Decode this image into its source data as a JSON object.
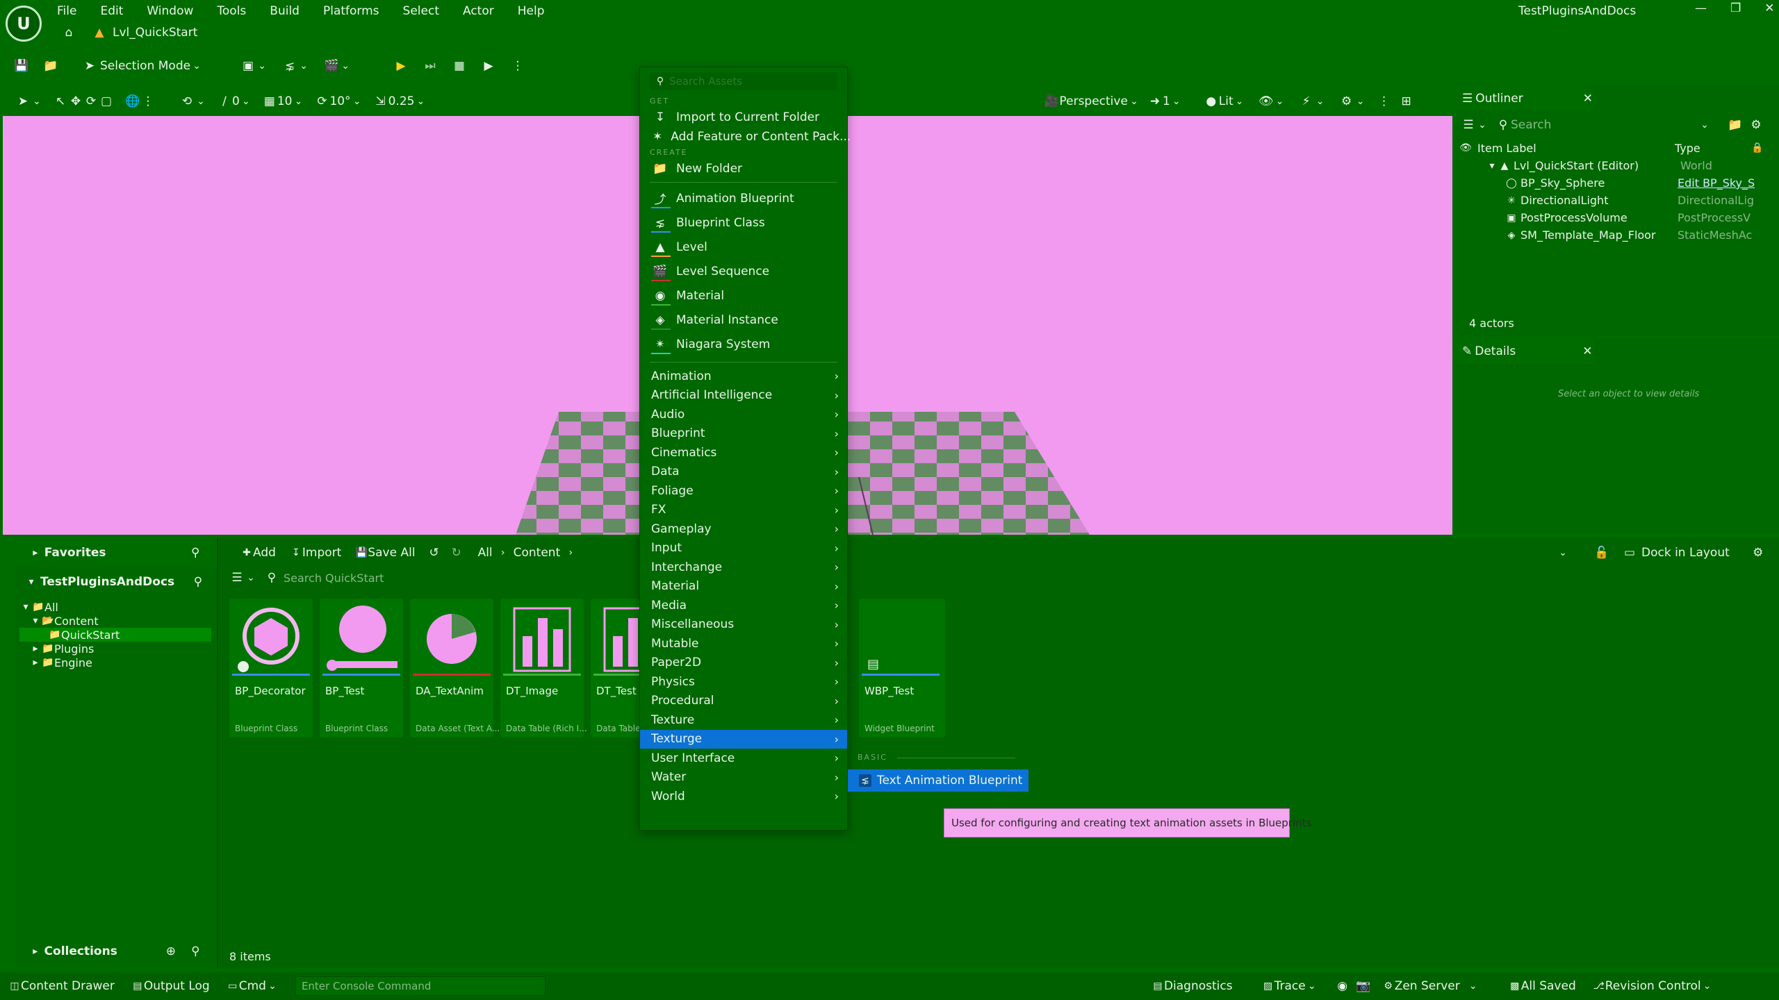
{
  "menubar": [
    "File",
    "Edit",
    "Window",
    "Tools",
    "Build",
    "Platforms",
    "Select",
    "Actor",
    "Help"
  ],
  "project_name": "TestPluginsAndDocs",
  "level_tab": "Lvl_QuickStart",
  "toolbar": {
    "selection_mode": "Selection Mode"
  },
  "viewport_toolbar": {
    "angle_snap_label": "0",
    "grid_snap": "10",
    "rotation_snap": "10°",
    "scale_snap": "0.25",
    "perspective": "Perspective",
    "camera_speed": "1",
    "view_mode": "Lit"
  },
  "outliner": {
    "tab": "Outliner",
    "search_placeholder": "Search",
    "col_label": "Item Label",
    "col_type": "Type",
    "root": {
      "label": "Lvl_QuickStart (Editor)",
      "type": "World"
    },
    "items": [
      {
        "label": "BP_Sky_Sphere",
        "type": "Edit BP_Sky_S"
      },
      {
        "label": "DirectionalLight",
        "type": "DirectionalLig"
      },
      {
        "label": "PostProcessVolume",
        "type": "PostProcessV"
      },
      {
        "label": "SM_Template_Map_Floor",
        "type": "StaticMeshAc"
      }
    ],
    "count": "4 actors"
  },
  "details": {
    "tab": "Details",
    "empty_text": "Select an object to view details"
  },
  "content_browser": {
    "favorites": "Favorites",
    "project": "TestPluginsAndDocs",
    "tree": [
      "All",
      "Content",
      "QuickStart",
      "Plugins",
      "Engine"
    ],
    "add": "Add",
    "import": "Import",
    "save_all": "Save All",
    "crumbs": [
      "All",
      "Content"
    ],
    "search_placeholder": "Search QuickStart",
    "dock_in_layout": "Dock in Layout",
    "collections": "Collections",
    "item_count": "8 items",
    "assets": [
      {
        "name": "BP_Decorator",
        "type": "Blueprint Class"
      },
      {
        "name": "BP_Test",
        "type": "Blueprint Class"
      },
      {
        "name": "DA_TextAnim",
        "type": "Data Asset (Text A..."
      },
      {
        "name": "DT_Image",
        "type": "Data Table (Rich I..."
      },
      {
        "name": "DT_Test",
        "type": "Data Table"
      },
      {
        "name": "WBP_Test",
        "type": "Widget Blueprint"
      }
    ]
  },
  "context_menu": {
    "search_placeholder": "Search Assets",
    "sections": {
      "get": "GET",
      "create": "CREATE",
      "basic": "BASIC"
    },
    "get_items": [
      "Import to Current Folder",
      "Add Feature or Content Pack..."
    ],
    "new_folder": "New Folder",
    "create_items": [
      "Animation Blueprint",
      "Blueprint Class",
      "Level",
      "Level Sequence",
      "Material",
      "Material Instance",
      "Niagara System"
    ],
    "categories": [
      "Animation",
      "Artificial Intelligence",
      "Audio",
      "Blueprint",
      "Cinematics",
      "Data",
      "Foliage",
      "FX",
      "Gameplay",
      "Input",
      "Interchange",
      "Material",
      "Media",
      "Miscellaneous",
      "Mutable",
      "Paper2D",
      "Physics",
      "Procedural",
      "Texture",
      "Texturge",
      "User Interface",
      "Water",
      "World"
    ],
    "selected_category": "Texturge",
    "submenu_item": "Text Animation Blueprint",
    "tooltip": "Used for configuring and creating text animation assets in Blueprints"
  },
  "statusbar": {
    "content_drawer": "Content Drawer",
    "output_log": "Output Log",
    "cmd": "Cmd",
    "console_placeholder": "Enter Console Command",
    "diagnostics": "Diagnostics",
    "trace": "Trace",
    "zen_server": "Zen Server",
    "all_saved": "All Saved",
    "revision_control": "Revision Control"
  },
  "colors": {
    "background": "#006c00",
    "viewport": "#f29af0",
    "selection": "#0c72d6",
    "play": "#ffd21e",
    "tooltip_bg": "#f4a8f0"
  }
}
